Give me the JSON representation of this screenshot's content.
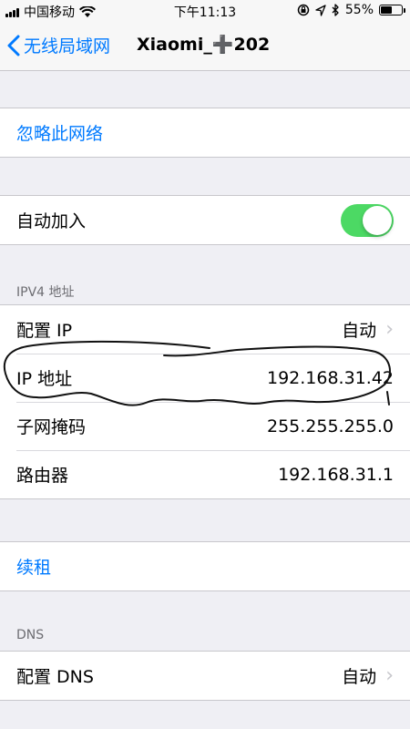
{
  "status_bar": {
    "carrier": "中国移动",
    "time": "下午11:13",
    "battery_percent": "55%",
    "battery_level": 0.55
  },
  "nav": {
    "back_label": "无线局域网",
    "title": "Xiaomi_➕202"
  },
  "actions": {
    "forget_network": "忽略此网络",
    "renew_lease": "续租"
  },
  "auto_join": {
    "label": "自动加入",
    "enabled": true
  },
  "ipv4": {
    "header": "IPV4 地址",
    "rows": [
      {
        "label": "配置 IP",
        "value": "自动"
      },
      {
        "label": "IP 地址",
        "value": "192.168.31.42"
      },
      {
        "label": "子网掩码",
        "value": "255.255.255.0"
      },
      {
        "label": "路由器",
        "value": "192.168.31.1"
      }
    ]
  },
  "dns": {
    "header": "DNS",
    "configure_label": "配置 DNS",
    "configure_value": "自动"
  },
  "colors": {
    "accent": "#007aff",
    "toggle_on": "#4cd964",
    "background": "#efeff4"
  }
}
